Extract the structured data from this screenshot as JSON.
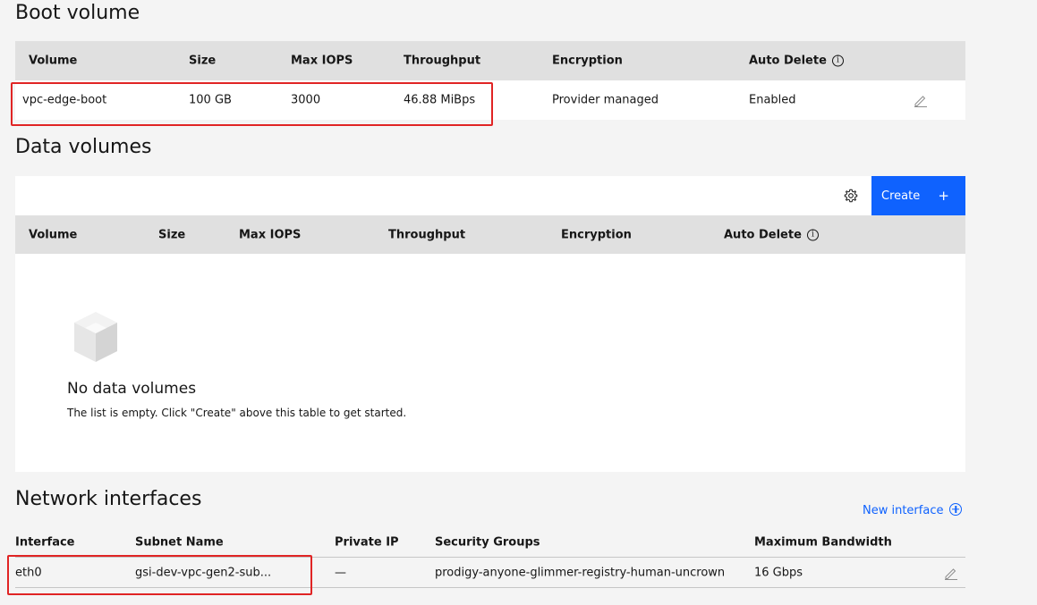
{
  "boot": {
    "title": "Boot volume",
    "columns": [
      "Volume",
      "Size",
      "Max IOPS",
      "Throughput",
      "Encryption",
      "Auto Delete"
    ],
    "row": {
      "volume": "vpc-edge-boot",
      "size": "100 GB",
      "iops": "3000",
      "throughput": "46.88 MiBps",
      "encryption": "Provider managed",
      "auto_delete": "Enabled"
    }
  },
  "data": {
    "title": "Data volumes",
    "create_label": "Create",
    "columns": [
      "Volume",
      "Size",
      "Max IOPS",
      "Throughput",
      "Encryption",
      "Auto Delete"
    ],
    "empty_title": "No data volumes",
    "empty_desc": "The list is empty. Click \"Create\" above this table to get started."
  },
  "network": {
    "title": "Network interfaces",
    "new_label": "New interface",
    "columns": [
      "Interface",
      "Subnet Name",
      "Private IP",
      "Security Groups",
      "Maximum Bandwidth"
    ],
    "row": {
      "interface": "eth0",
      "subnet": "gsi-dev-vpc-gen2-sub...",
      "private_ip": "—",
      "security_groups": "prodigy-anyone-glimmer-registry-human-uncrown",
      "bandwidth": "16 Gbps"
    }
  },
  "colors": {
    "accent": "#0f62fe",
    "highlight": "#e02424",
    "header_bg": "#e0e0e0",
    "page_bg": "#f4f4f4"
  }
}
